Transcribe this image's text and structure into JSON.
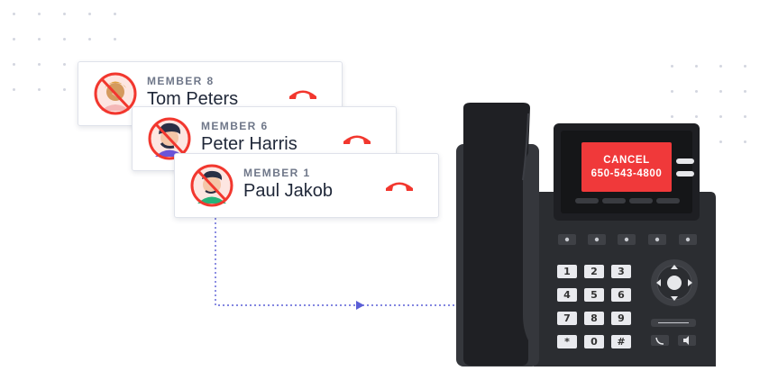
{
  "members": [
    {
      "tag": "MEMBER 8",
      "name": "Tom Peters"
    },
    {
      "tag": "MEMBER 6",
      "name": "Peter Harris"
    },
    {
      "tag": "MEMBER 1",
      "name": "Paul Jakob"
    }
  ],
  "phone": {
    "screen_line1": "CANCEL",
    "screen_line2": "650-543-4800",
    "keys": [
      "1",
      "2",
      "3",
      "4",
      "5",
      "6",
      "7",
      "8",
      "9",
      "*",
      "0",
      "#"
    ]
  },
  "colors": {
    "hangup_red": "#f2372e",
    "screen_red": "#f0393a",
    "phone_body": "#2b2d31",
    "connector": "#5a5ed6"
  },
  "icons": [
    "no-call-icon",
    "hang-up-icon",
    "handset-icon",
    "navigation-pad-icon",
    "arrow-right-icon"
  ]
}
